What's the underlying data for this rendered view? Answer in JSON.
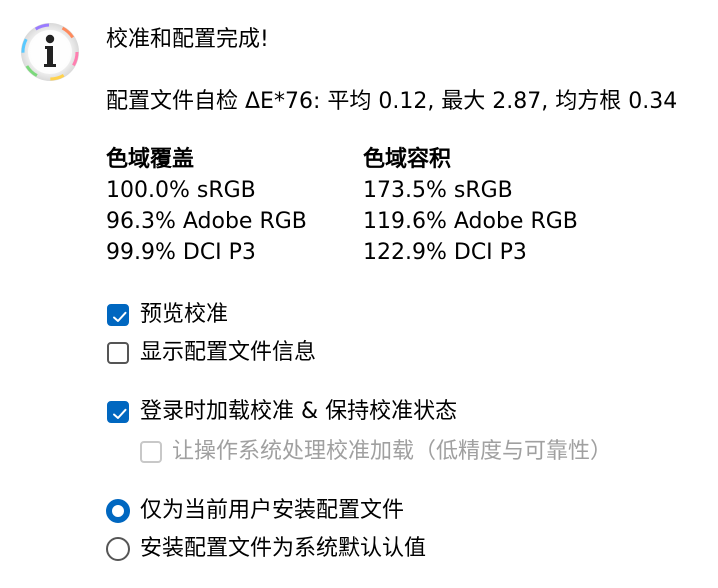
{
  "icon": "info-icon",
  "title": "校准和配置完成!",
  "self_check": "配置文件自检 ΔE*76: 平均 0.12, 最大 2.87, 均方根 0.34",
  "coverage": {
    "header": "色域覆盖",
    "rows": [
      "100.0% sRGB",
      "96.3% Adobe RGB",
      "99.9% DCI P3"
    ]
  },
  "volume": {
    "header": "色域容积",
    "rows": [
      "173.5% sRGB",
      "119.6% Adobe RGB",
      "122.9% DCI P3"
    ]
  },
  "options": {
    "preview_calibration": {
      "label": "预览校准",
      "checked": true
    },
    "show_profile_info": {
      "label": "显示配置文件信息",
      "checked": false
    },
    "load_on_login": {
      "label": "登录时加载校准 & 保持校准状态",
      "checked": true
    },
    "os_handles_loading": {
      "label": "让操作系统处理校准加载（低精度与可靠性）",
      "checked": false,
      "disabled": true
    }
  },
  "install_scope": {
    "current_user": {
      "label": "仅为当前用户安装配置文件",
      "selected": true
    },
    "system_default": {
      "label": "安装配置文件为系统默认认值",
      "selected": false
    }
  },
  "colors": {
    "accent": "#0067c0",
    "disabled": "#a0a0a0"
  }
}
